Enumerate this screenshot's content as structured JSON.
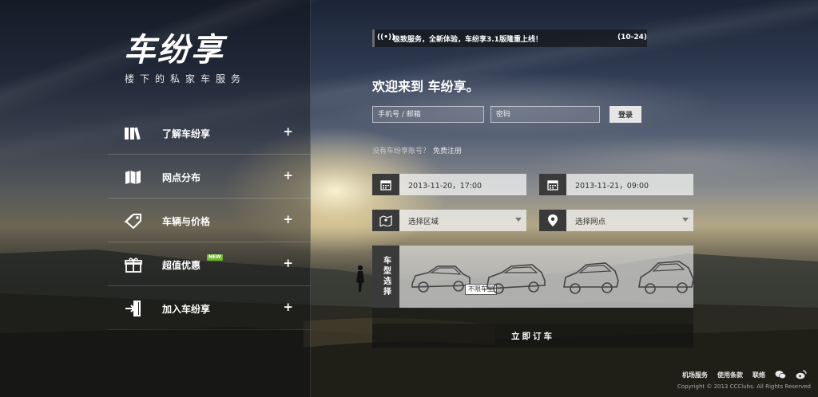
{
  "brand": {
    "logo": "车纷享",
    "slogan": "楼下的私家车服务"
  },
  "menu": [
    {
      "label": "了解车纷享",
      "icon": "books-icon"
    },
    {
      "label": "网点分布",
      "icon": "map-icon"
    },
    {
      "label": "车辆与价格",
      "icon": "price-tag-icon"
    },
    {
      "label": "超值优惠",
      "icon": "gift-icon",
      "badge": "NEW"
    },
    {
      "label": "加入车纷享",
      "icon": "enter-icon"
    }
  ],
  "menu_plus": "+",
  "notice": {
    "text": "极致服务，全新体验，车纷享3.1版隆重上线！",
    "date": "(10-24)"
  },
  "login": {
    "welcome": "欢迎来到 车纷享。",
    "phone_placeholder": "手机号 / 邮箱",
    "password_placeholder": "密码",
    "login_button": "登录",
    "no_account": "没有车纷享账号？",
    "register": "免费注册"
  },
  "booking": {
    "start_time": "2013-11-20，17:00",
    "end_time": "2013-11-21，09:00",
    "region_placeholder": "选择区域",
    "station_placeholder": "选择网点",
    "car_type_label": "车型选择",
    "car_type_default": "不限车型",
    "book_button": "立即订车"
  },
  "footer": {
    "links": [
      "机场服务",
      "使用条款",
      "联络"
    ],
    "copyright": "Copyright © 2013 CCClubs. All Rights Reserved"
  }
}
